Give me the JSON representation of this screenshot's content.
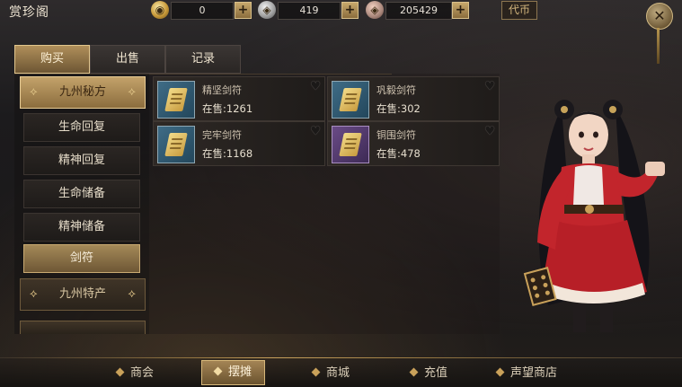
{
  "header": {
    "title": "赏珍阁",
    "currencies": [
      {
        "value": "0",
        "icon": "gold-coin-icon"
      },
      {
        "value": "419",
        "icon": "silver-coin-icon"
      },
      {
        "value": "205429",
        "icon": "copper-coin-icon"
      }
    ],
    "token_label": "代币",
    "close_icon": "close-icon"
  },
  "tabs": [
    {
      "label": "购买",
      "active": true
    },
    {
      "label": "出售",
      "active": false
    },
    {
      "label": "记录",
      "active": false
    }
  ],
  "categories": {
    "main_1": "九州秘方",
    "subs": [
      "生命回复",
      "精神回复",
      "生命储备",
      "精神储备",
      "剑符"
    ],
    "active_sub": "剑符",
    "main_2": "九州特产"
  },
  "items": [
    {
      "name": "精坚剑符",
      "stock": "在售:1261",
      "rarity": "blue"
    },
    {
      "name": "巩毅剑符",
      "stock": "在售:302",
      "rarity": "blue"
    },
    {
      "name": "完牢剑符",
      "stock": "在售:1168",
      "rarity": "blue"
    },
    {
      "name": "铜围剑符",
      "stock": "在售:478",
      "rarity": "purple"
    }
  ],
  "bottom_nav": [
    {
      "label": "商会",
      "active": false
    },
    {
      "label": "摆摊",
      "active": true
    },
    {
      "label": "商城",
      "active": false
    },
    {
      "label": "充值",
      "active": false
    },
    {
      "label": "声望商店",
      "active": false
    }
  ],
  "colors": {
    "accent_gold": "#c9a15a",
    "panel_dark": "#1c1b1d",
    "rare_blue": "#3f6c86",
    "epic_purple": "#6a4b86"
  }
}
